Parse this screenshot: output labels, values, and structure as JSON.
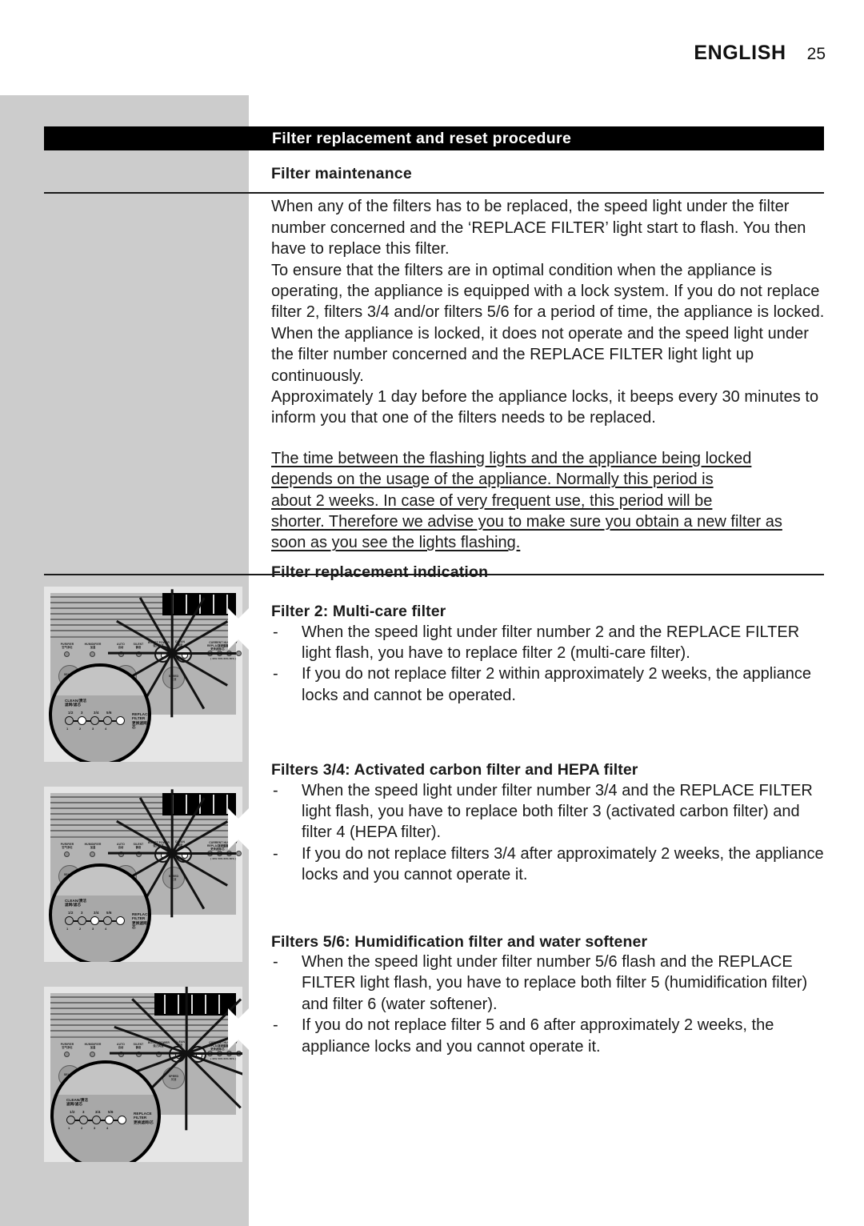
{
  "header": {
    "language": "ENGLISH",
    "page_number": "25"
  },
  "banner": {
    "title": "Filter replacement and reset procedure"
  },
  "sections": {
    "filter_maintenance": {
      "heading": "Filter maintenance",
      "paragraph_1": "When any of the filters has to be replaced, the speed light under the filter number concerned and the ‘REPLACE FILTER’ light start to flash. You then have to replace this filter.",
      "paragraph_2": "To ensure that the filters are in optimal condition when the appliance is operating, the appliance is equipped with a lock system. If you do not replace filter 2, filters 3/4 and/or filters 5/6 for a period of time, the appliance is locked. When the appliance is locked, it does not operate and the speed light under the filter number concerned and the REPLACE FILTER light light up continuously.",
      "paragraph_3": "Approximately 1 day before the appliance locks, it beeps every 30 minutes to inform you that one of the filters needs to be replaced."
    },
    "note": {
      "lines": [
        "The time between the flashing lights and the appliance being locked",
        "depends on the usage of the appliance. Normally this period is",
        "about 2 weeks. In case of very frequent use, this period will be",
        "shorter. Therefore we advise you to make sure you obtain a new filter as",
        "soon as you see the lights flashing."
      ]
    },
    "replacement_indication": {
      "heading": "Filter replacement indication"
    },
    "filter_2": {
      "heading": "Filter 2: Multi-care filter",
      "bullets": [
        "When the speed light under filter number 2  and the REPLACE FILTER light flash,  you have to replace filter 2 (multi-care filter).",
        "If you do not replace filter 2 within approximately 2 weeks, the appliance locks and cannot be operated."
      ]
    },
    "filters_34": {
      "heading": "Filters 3/4: Activated carbon filter and HEPA filter",
      "bullets": [
        "When the speed light under filter number 3/4 and the REPLACE FILTER light flash, you have to replace both filter 3 (activated carbon filter) and filter 4 (HEPA filter).",
        "If you do not replace filters 3/4 after approximately 2 weeks, the appliance locks and you cannot operate it."
      ]
    },
    "filters_56": {
      "heading": "Filters 5/6: Humidification filter and water softener",
      "bullets": [
        "When the speed light under filter number 5/6 flash and the REPLACE FILTER light flash, you have to replace both filter 5 (humidification filter) and filter 6 (water softener).",
        "If you do not replace filter 5 and 6 after approximately 2 weeks, the appliance locks and you cannot operate it."
      ]
    }
  },
  "illustrations": {
    "panel_labels": {
      "purifier": "PURIFIER",
      "purifier_cn": "空气净化",
      "humidifier": "HUMIDIFIER",
      "humidifier_cn": "加湿",
      "auto": "AUTO",
      "auto_cn": "自动",
      "silent": "SILENT",
      "silent_cn": "静音",
      "boost_power": "BOOST POWER",
      "boost_power_cn": "强力风速",
      "clean": "CLEAN",
      "clean_cn": "清洁",
      "replace_filter": "REPLACE FILTER",
      "replace_filter_cn": "更换滤网/芯",
      "current_humidity": "CURRENT HUMIDITY",
      "current_humidity_cn": "当前湿度",
      "humidity_scale": "( 40%  50%  60%  80% )",
      "select": "SELECT",
      "select_cn": "选择",
      "mode": "MODE",
      "mode_cn": "模式",
      "speed": "SPEED",
      "speed_cn": "风速"
    },
    "magnifier": {
      "clean_label": "CLEAN/清洁",
      "filter_label": "滤网/滤芯",
      "replace_line1": "REPLACE",
      "replace_line2": "FILTER",
      "replace_line3": "更换滤网/芯",
      "filter_numbers": [
        "1/2",
        "3",
        "3/4",
        "5/6"
      ],
      "speed_marks": [
        "1",
        "2",
        "3",
        "4"
      ]
    },
    "items": [
      {
        "caption_ref": "filter_2",
        "lit_leds": [
          1,
          4
        ]
      },
      {
        "caption_ref": "filters_34",
        "lit_leds": [
          2,
          4
        ]
      },
      {
        "caption_ref": "filters_56",
        "lit_leds": [
          3,
          4
        ]
      }
    ]
  }
}
